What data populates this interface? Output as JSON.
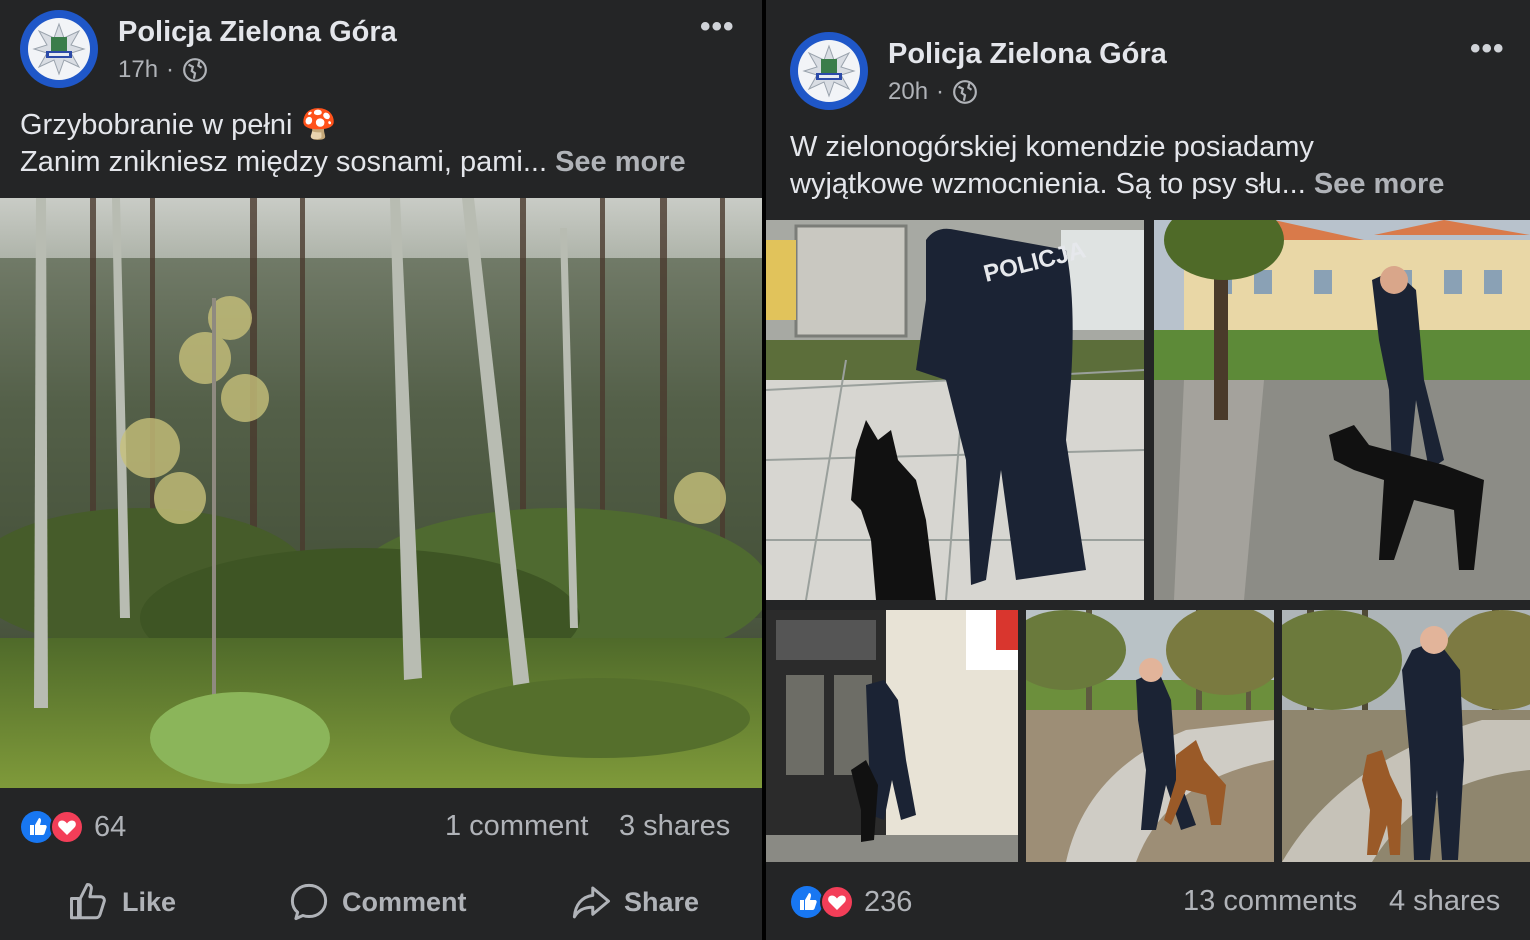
{
  "posts": [
    {
      "page_name": "Policja Zielona Góra",
      "time": "17h",
      "separator": "·",
      "caption_line1": "Grzybobranie w pełni",
      "caption_emoji": "🍄",
      "caption_line2": "Zanim znikniesz między sosnami, pami...",
      "see_more": "See more",
      "reactions_count": "64",
      "comments": "1 comment",
      "shares": "3 shares",
      "actions": {
        "like": "Like",
        "comment": "Comment",
        "share": "Share"
      }
    },
    {
      "page_name": "Policja Zielona Góra",
      "time": "20h",
      "separator": "·",
      "caption_line1": "W zielonogórskiej komendzie posiadamy",
      "caption_line2": "wyjątkowe wzmocnienia. Są to psy słu...",
      "see_more": "See more",
      "reactions_count": "236",
      "comments": "13 comments",
      "shares": "4 shares",
      "photo_labels": {
        "jacket": "POLICJA"
      }
    }
  ],
  "colors": {
    "card_bg": "#242526",
    "text_primary": "#e4e6eb",
    "text_secondary": "#b0b3b8",
    "like_blue": "#1877f2",
    "love_red": "#f33e58"
  },
  "icons": [
    "globe-icon",
    "more-options-icon",
    "like-reaction-icon",
    "love-reaction-icon",
    "like-icon",
    "comment-icon",
    "share-icon"
  ]
}
